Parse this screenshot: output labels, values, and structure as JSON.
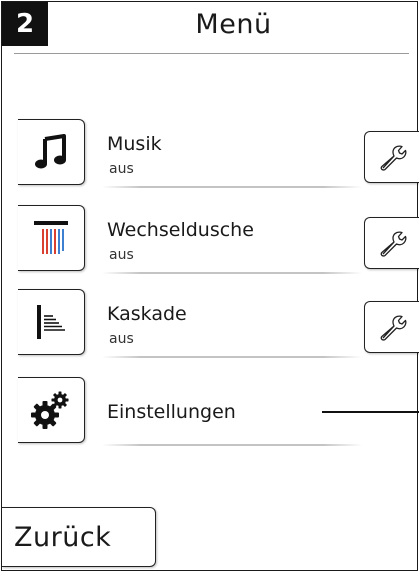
{
  "header": {
    "screen_number": "2",
    "title": "Menü"
  },
  "menu": {
    "items": [
      {
        "icon": "music-note-icon",
        "label": "Musik",
        "status": "aus",
        "has_settings": true
      },
      {
        "icon": "alternating-shower-icon",
        "label": "Wechseldusche",
        "status": "aus",
        "has_settings": true
      },
      {
        "icon": "cascade-icon",
        "label": "Kaskade",
        "status": "aus",
        "has_settings": true
      },
      {
        "icon": "gears-icon",
        "label": "Einstellungen",
        "status": "",
        "has_settings": false
      }
    ]
  },
  "footer": {
    "back_label": "Zurück"
  },
  "colors": {
    "shower_hot": "#d9402f",
    "shower_cold": "#3d7fd0",
    "text": "#1a1a1a"
  }
}
